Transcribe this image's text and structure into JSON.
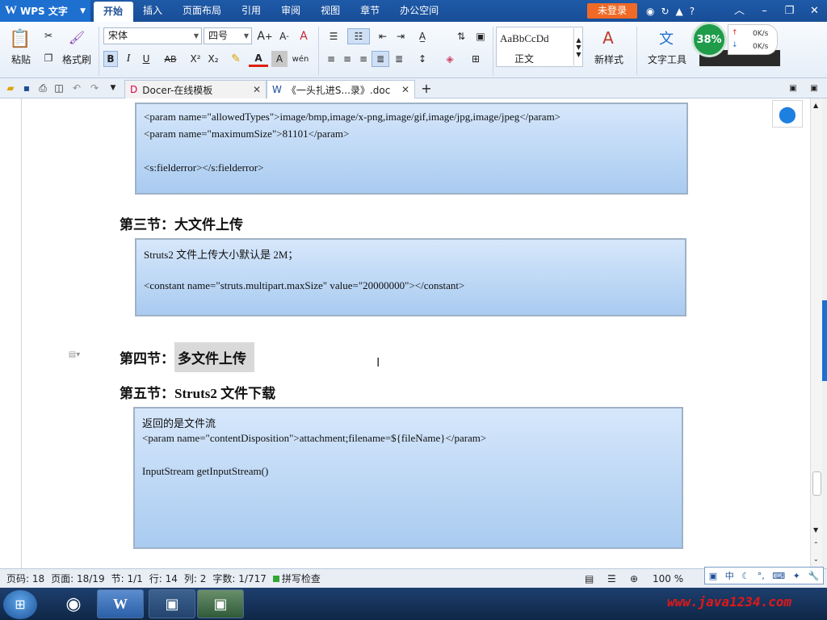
{
  "app": {
    "name": "WPS 文字",
    "logo": "W"
  },
  "menu": [
    "开始",
    "插入",
    "页面布局",
    "引用",
    "审阅",
    "视图",
    "章节",
    "办公空间"
  ],
  "login_label": "未登录",
  "ribbon": {
    "paste_label": "粘贴",
    "format_painter_label": "格式刷",
    "font_name": "宋体",
    "font_size": "四号",
    "style_sample": "AaBbCcDd",
    "style_name": "正文",
    "new_style_label": "新样式",
    "text_tools_label": "文字工具",
    "bold_label": "B",
    "italic_label": "I",
    "underline_label": "U",
    "strike_label": "AB",
    "superscript_label": "X²",
    "subscript_label": "X₂"
  },
  "net_monitor": {
    "percent": "38%",
    "up": "0K/s",
    "down": "0K/s"
  },
  "tabs": [
    {
      "label": "Docer-在线模板"
    },
    {
      "label": "《一头扎进S...录》.doc"
    }
  ],
  "document": {
    "box1_lines": [
      "<param name=\"allowedTypes\">image/bmp,image/x-png,image/gif,image/jpg,image/jpeg</param>",
      "<param name=\"maximumSize\">81101</param>",
      "<s:fielderror></s:fielderror>"
    ],
    "heading3": "第三节：大文件上传",
    "box2_lines": [
      "Struts2 文件上传大小默认是  2M；",
      "<constant name=\"struts.multipart.maxSize\" value=\"20000000\"></constant>"
    ],
    "heading4_prefix": "第四节：",
    "heading4_highlight": "多文件上传",
    "heading5": "第五节：Struts2 文件下载",
    "box3_lines": [
      "返回的是文件流",
      "<param name=\"contentDisposition\">attachment;filename=${fileName}</param>",
      "InputStream getInputStream()"
    ]
  },
  "status": {
    "page_num": "页码: 18",
    "pages": "页面: 18/19",
    "section": "节: 1/1",
    "row": "行: 14",
    "col": "列: 2",
    "words": "字数: 1/717",
    "spell": "拼写检查",
    "zoom": "100 %"
  },
  "ime": {
    "lang": "中"
  },
  "watermark": "www.java1234.com"
}
